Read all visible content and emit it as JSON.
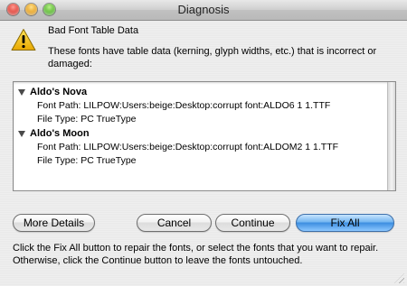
{
  "window": {
    "title": "Diagnosis"
  },
  "alert": {
    "icon": "warning-triangle-icon",
    "heading": "Bad Font Table Data",
    "description": "These fonts have table data (kerning, glyph widths, etc.) that is incorrect or damaged:"
  },
  "font_list": {
    "items": [
      {
        "name": "Aldo's Nova",
        "expanded": true,
        "font_path": "Font Path: LILPOW:Users:beige:Desktop:corrupt font:ALDO6 1 1.TTF",
        "file_type": "File Type: PC TrueType"
      },
      {
        "name": "Aldo's Moon",
        "expanded": true,
        "font_path": "Font Path: LILPOW:Users:beige:Desktop:corrupt font:ALDOM2 1 1.TTF",
        "file_type": "File Type: PC TrueType"
      }
    ]
  },
  "buttons": {
    "more_details": "More Details",
    "cancel": "Cancel",
    "continue": "Continue",
    "fix_all": "Fix All"
  },
  "footer": {
    "text": "Click the Fix All button to repair the fonts, or select the fonts that you want to repair. Otherwise, click the Continue button to leave the fonts untouched."
  },
  "colors": {
    "default_button": "#3b8de0",
    "warning_fill": "#f5c400"
  }
}
